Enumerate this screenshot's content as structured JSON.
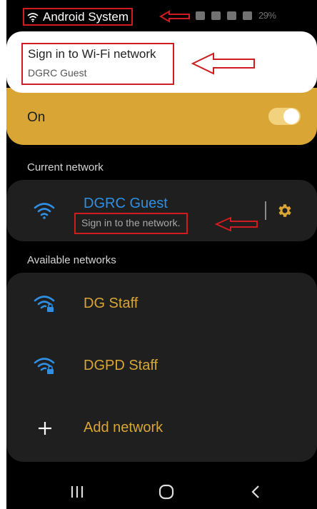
{
  "status_bar": {
    "notification_app": "Android System",
    "battery": "29%"
  },
  "notification": {
    "title": "Sign in to Wi-Fi network",
    "subtitle": "DGRC Guest"
  },
  "wifi_toggle": {
    "label": "On",
    "state": "on"
  },
  "current_network": {
    "section_label": "Current network",
    "name": "DGRC Guest",
    "status": "Sign in to the network."
  },
  "available_networks": {
    "section_label": "Available networks",
    "items": [
      {
        "name": "DG Staff",
        "icon": "wifi-lock-icon"
      },
      {
        "name": "DGPD Staff",
        "icon": "wifi-lock-icon"
      }
    ],
    "add_label": "Add network"
  },
  "nav": {
    "recents_icon": "recents-icon",
    "home_icon": "home-icon",
    "back_icon": "back-icon"
  },
  "colors": {
    "accent": "#d9a636",
    "link_blue": "#2f8fe3",
    "annotation_red": "#d01c1f",
    "card_bg": "#1f1f1f"
  }
}
